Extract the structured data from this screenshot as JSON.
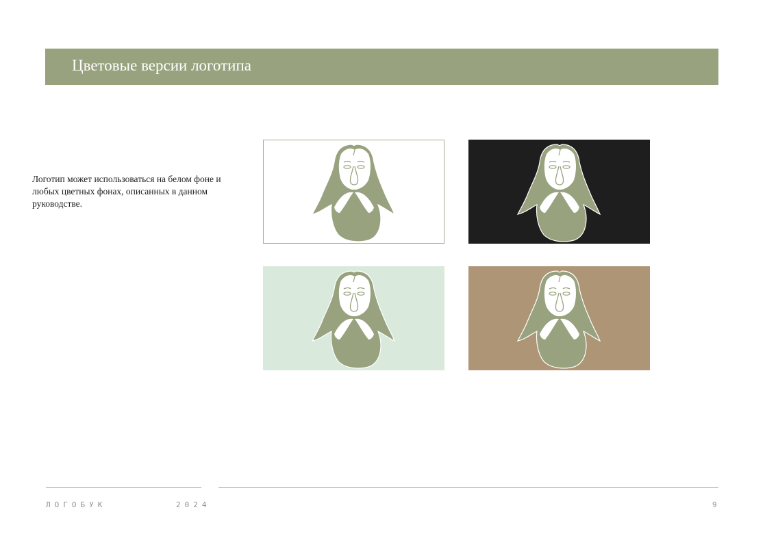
{
  "header": {
    "title": "Цветовые версии логотипа"
  },
  "description": "Логотип может использоваться на белом фоне и любых цветных фонах, описанных в данном руководстве.",
  "logo_color": "#98a27e",
  "tiles": [
    {
      "background": "#ffffff"
    },
    {
      "background": "#1e1e1e"
    },
    {
      "background": "#d9e9dc"
    },
    {
      "background": "#ae9576"
    }
  ],
  "footer": {
    "brand": "ЛОГОБУК",
    "year": "2024",
    "page_number": "9"
  }
}
